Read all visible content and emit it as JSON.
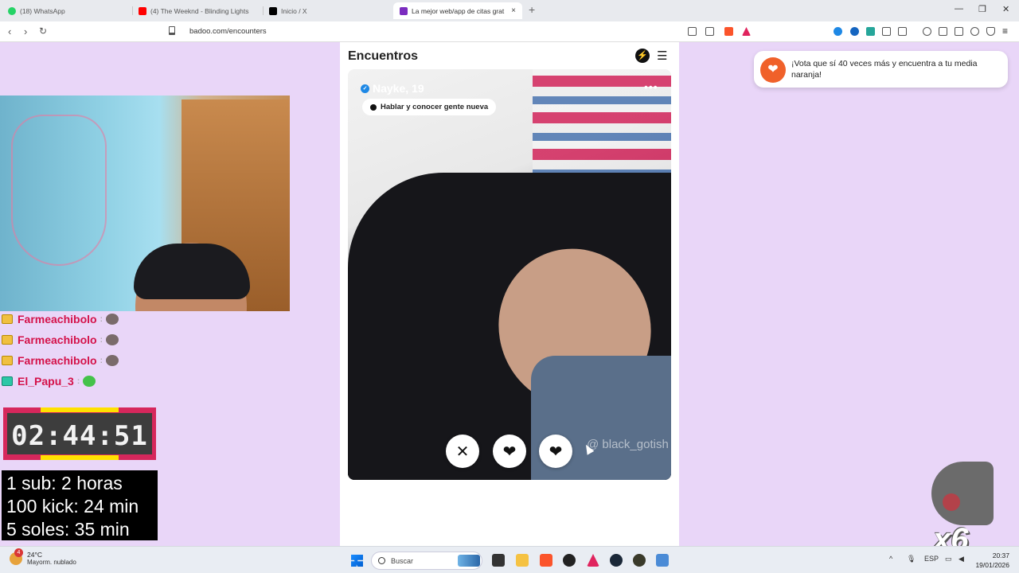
{
  "browser": {
    "tabs": [
      {
        "title": "(18) WhatsApp",
        "color": "#25d366"
      },
      {
        "title": "(4) The Weeknd - Blinding Lights",
        "color": "#ff0000"
      },
      {
        "title": "Inicio / X",
        "color": "#000000"
      },
      {
        "title": "La mejor web/app de citas grat",
        "color": "#7b2cbf"
      }
    ],
    "new_tab": "+",
    "close_tab": "×",
    "url": "badoo.com/encounters",
    "controls": {
      "minimize": "—",
      "maximize": "❐",
      "close": "✕"
    }
  },
  "stream": {
    "chat": [
      {
        "user": "Farmeachibolo",
        "badge": "gold",
        "emote": "grey"
      },
      {
        "user": "Farmeachibolo",
        "badge": "gold",
        "emote": "grey"
      },
      {
        "user": "Farmeachibolo",
        "badge": "gold",
        "emote": "grey"
      },
      {
        "user": "El_Papu_3",
        "badge": "green",
        "emote": "green"
      }
    ],
    "timer": "02:44:51",
    "goals": [
      "1 sub: 2 horas",
      "100 kick: 24 min",
      "5 soles: 35 min"
    ],
    "multiplier": "x6"
  },
  "badoo": {
    "title": "Encuentros",
    "profile": {
      "name": "Nayke, 19",
      "tag": "Hablar y conocer gente nueva",
      "watermark": "@ black_gotish"
    },
    "actions": {
      "dislike": "✕",
      "superlike": "❤",
      "like": "❤"
    },
    "toast": "¡Vota que sí 40 veces más y encuentra a tu media naranja!"
  },
  "taskbar": {
    "weather_badge": "4",
    "temperature": "24°C",
    "condition": "Mayorm. nublado",
    "search_placeholder": "Buscar",
    "language": "ESP",
    "time": "20:37",
    "date": "19/01/2026"
  }
}
